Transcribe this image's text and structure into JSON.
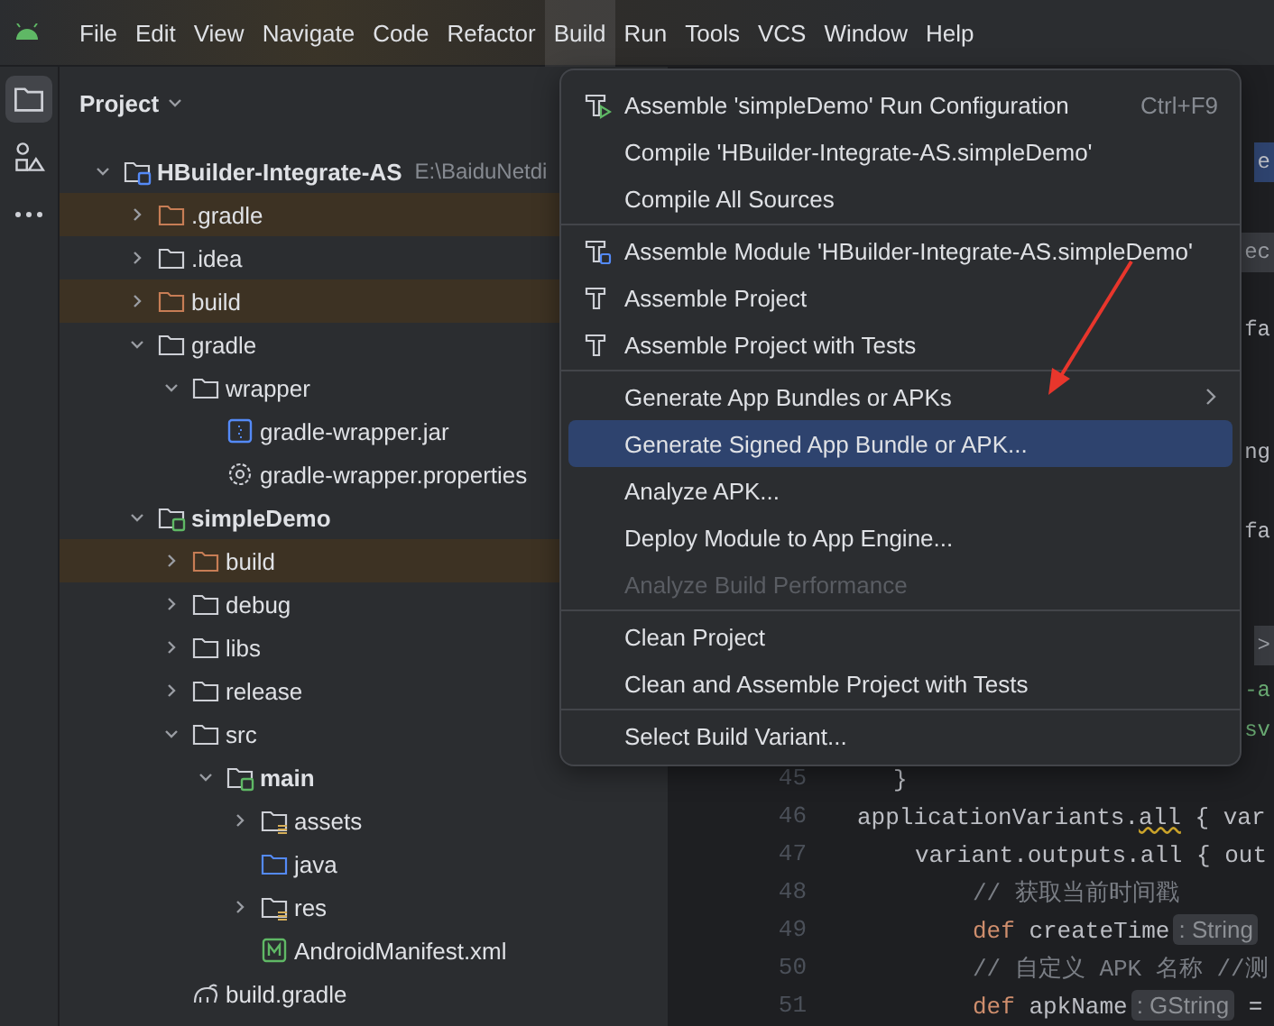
{
  "menu_bar": [
    {
      "label": "File",
      "selected": false
    },
    {
      "label": "Edit",
      "selected": false
    },
    {
      "label": "View",
      "selected": false
    },
    {
      "label": "Navigate",
      "selected": false
    },
    {
      "label": "Code",
      "selected": false
    },
    {
      "label": "Refactor",
      "selected": false
    },
    {
      "label": "Build",
      "selected": true
    },
    {
      "label": "Run",
      "selected": false
    },
    {
      "label": "Tools",
      "selected": false
    },
    {
      "label": "VCS",
      "selected": false
    },
    {
      "label": "Window",
      "selected": false
    },
    {
      "label": "Help",
      "selected": false
    }
  ],
  "tool_strip": [
    {
      "kind": "folder",
      "selected": true
    },
    {
      "kind": "structure",
      "selected": false
    },
    {
      "kind": "more",
      "selected": false
    }
  ],
  "project_panel": {
    "title": "Project",
    "tree": [
      {
        "label": "HBuilder-Integrate-AS",
        "path": "E:\\BaiduNetdi",
        "kind": "module",
        "bold": true,
        "expanded": true,
        "excluded": false,
        "children": [
          {
            "label": ".gradle",
            "kind": "folder",
            "expanded": false,
            "excluded": true
          },
          {
            "label": ".idea",
            "kind": "folder",
            "expanded": false,
            "excluded": false
          },
          {
            "label": "build",
            "kind": "folder",
            "expanded": false,
            "excluded": true
          },
          {
            "label": "gradle",
            "kind": "folder",
            "expanded": true,
            "excluded": false,
            "children": [
              {
                "label": "wrapper",
                "kind": "folder",
                "expanded": true,
                "excluded": false,
                "children": [
                  {
                    "label": "gradle-wrapper.jar",
                    "kind": "jar",
                    "excluded": false
                  },
                  {
                    "label": "gradle-wrapper.properties",
                    "kind": "settings",
                    "excluded": false
                  }
                ]
              }
            ]
          },
          {
            "label": "simpleDemo",
            "kind": "android-module",
            "bold": true,
            "expanded": true,
            "excluded": false,
            "children": [
              {
                "label": "build",
                "kind": "folder",
                "expanded": false,
                "excluded": true
              },
              {
                "label": "debug",
                "kind": "folder",
                "expanded": false,
                "excluded": false
              },
              {
                "label": "libs",
                "kind": "folder",
                "expanded": false,
                "excluded": false
              },
              {
                "label": "release",
                "kind": "folder",
                "expanded": false,
                "excluded": false
              },
              {
                "label": "src",
                "kind": "folder",
                "expanded": true,
                "excluded": false,
                "children": [
                  {
                    "label": "main",
                    "kind": "android-module",
                    "bold": true,
                    "expanded": true,
                    "excluded": false,
                    "children": [
                      {
                        "label": "assets",
                        "kind": "resource",
                        "expanded": false,
                        "excluded": false
                      },
                      {
                        "label": "java",
                        "kind": "source",
                        "excluded": false
                      },
                      {
                        "label": "res",
                        "kind": "resource",
                        "expanded": false,
                        "excluded": false
                      },
                      {
                        "label": "AndroidManifest.xml",
                        "kind": "manifest",
                        "excluded": false
                      }
                    ]
                  }
                ]
              },
              {
                "label": "build.gradle",
                "kind": "gradle",
                "excluded": false
              }
            ]
          }
        ]
      }
    ]
  },
  "editor": {
    "fragments": [
      {
        "text": "e",
        "kind": "banner"
      },
      {
        "text": "ec",
        "kind": "chip"
      },
      {
        "text": "fa",
        "kind": "plain"
      },
      {
        "text": "ng",
        "kind": "plain"
      },
      {
        "text": "fa",
        "kind": "plain"
      },
      {
        "text": ">",
        "kind": "chip"
      },
      {
        "text": "-a",
        "kind": "string"
      },
      {
        "text": "sv",
        "kind": "string"
      }
    ],
    "lines": [
      {
        "number": "45",
        "tokens": [
          {
            "text": "}",
            "kind": "plain"
          }
        ]
      },
      {
        "number": "46",
        "tokens": [
          {
            "text": "applicationVariants.",
            "kind": "plain"
          },
          {
            "text": "all",
            "kind": "warning"
          },
          {
            "text": " { var",
            "kind": "plain"
          }
        ]
      },
      {
        "number": "47",
        "tokens": [
          {
            "text": "variant.outputs.all { out",
            "kind": "plain"
          }
        ]
      },
      {
        "number": "48",
        "tokens": [
          {
            "text": "// 获取当前时间戳",
            "kind": "comment"
          }
        ]
      },
      {
        "number": "49",
        "tokens": [
          {
            "text": "def",
            "kind": "keyword"
          },
          {
            "text": " createTime",
            "kind": "plain"
          },
          {
            "text": ": String",
            "kind": "hint"
          }
        ]
      },
      {
        "number": "50",
        "tokens": [
          {
            "text": "// 自定义 APK 名称 //测",
            "kind": "comment"
          }
        ]
      },
      {
        "number": "51",
        "tokens": [
          {
            "text": "def",
            "kind": "keyword"
          },
          {
            "text": " apkName",
            "kind": "plain"
          },
          {
            "text": ": GString",
            "kind": "hint"
          },
          {
            "text": " =",
            "kind": "plain"
          }
        ]
      }
    ]
  },
  "build_menu": {
    "groups": [
      [
        {
          "label": "Assemble 'simpleDemo' Run Configuration",
          "kind": "run-config",
          "shortcut": "Ctrl+F9",
          "selected": false,
          "disabled": false
        },
        {
          "label": "Compile 'HBuilder-Integrate-AS.simpleDemo'",
          "kind": "plain",
          "selected": false,
          "disabled": false
        },
        {
          "label": "Compile All Sources",
          "kind": "plain",
          "selected": false,
          "disabled": false
        }
      ],
      [
        {
          "label": "Assemble Module 'HBuilder-Integrate-AS.simpleDemo'",
          "kind": "module-build",
          "selected": false,
          "disabled": false
        },
        {
          "label": "Assemble Project",
          "kind": "project-build",
          "selected": false,
          "disabled": false
        },
        {
          "label": "Assemble Project with Tests",
          "kind": "project-build",
          "selected": false,
          "disabled": false
        }
      ],
      [
        {
          "label": "Generate App Bundles or APKs",
          "kind": "plain",
          "submenu": true,
          "selected": false,
          "disabled": false
        },
        {
          "label": "Generate Signed App Bundle or APK...",
          "kind": "plain",
          "selected": true,
          "disabled": false
        },
        {
          "label": "Analyze APK...",
          "kind": "plain",
          "selected": false,
          "disabled": false
        },
        {
          "label": "Deploy Module to App Engine...",
          "kind": "plain",
          "selected": false,
          "disabled": false
        },
        {
          "label": "Analyze Build Performance",
          "kind": "plain",
          "selected": false,
          "disabled": true
        }
      ],
      [
        {
          "label": "Clean Project",
          "kind": "plain",
          "selected": false,
          "disabled": false
        },
        {
          "label": "Clean and Assemble Project with Tests",
          "kind": "plain",
          "selected": false,
          "disabled": false
        }
      ],
      [
        {
          "label": "Select Build Variant...",
          "kind": "plain",
          "selected": false,
          "disabled": false
        }
      ]
    ]
  }
}
